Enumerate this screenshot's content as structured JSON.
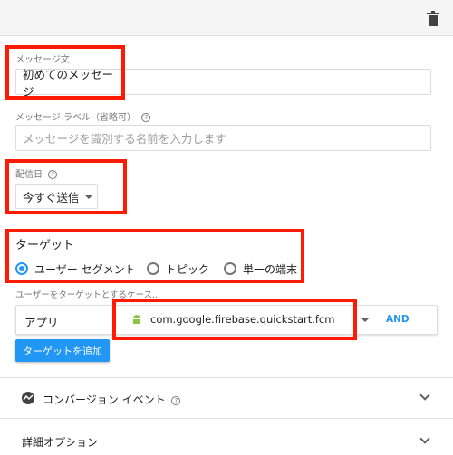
{
  "message": {
    "text_label": "メッセージ文",
    "text_value": "初めてのメッセージ",
    "label_label": "メッセージ ラベル（省略可）",
    "label_placeholder": "メッセージを識別する名前を入力します"
  },
  "schedule": {
    "label": "配信日",
    "selected": "今すぐ送信"
  },
  "target": {
    "heading": "ターゲット",
    "options": [
      "ユーザー セグメント",
      "トピック",
      "単一の端末"
    ],
    "selected_index": 0,
    "hint": "ユーザーをターゲットとするケース...",
    "type_selected": "アプリ",
    "app_selected": "com.google.firebase.quickstart.fcm",
    "and_label": "AND",
    "add_button": "ターゲットを追加"
  },
  "sections": {
    "conversion": "コンバージョン イベント",
    "advanced": "詳細オプション"
  },
  "colors": {
    "accent": "#2196f3",
    "highlight": "#ff1a00",
    "android": "#8bc34a"
  },
  "icons": {
    "delete": "trash-icon",
    "help": "help-circle-icon",
    "conversion": "trend-icon",
    "platform": "android-icon"
  }
}
